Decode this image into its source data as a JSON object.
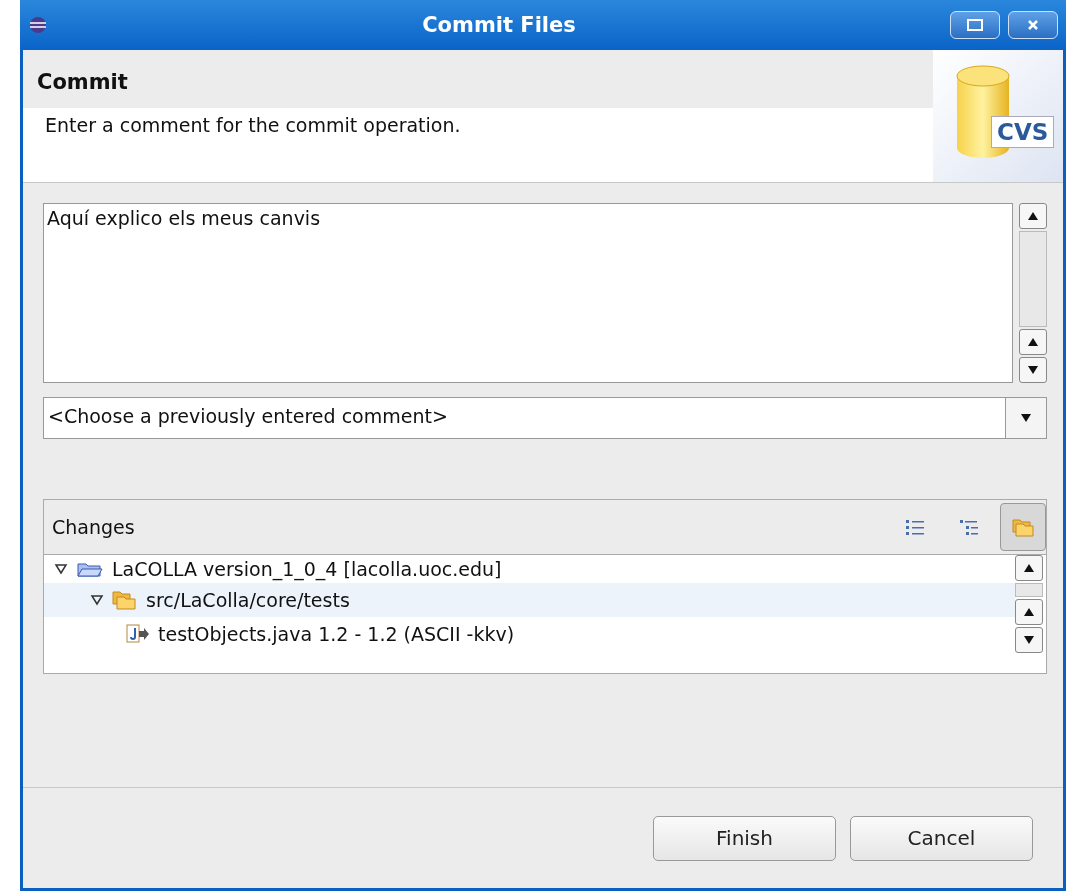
{
  "window": {
    "title": "Commit Files"
  },
  "header": {
    "title": "Commit",
    "description": "Enter a comment for the commit operation.",
    "logo_text": "CVS"
  },
  "comment": {
    "value": "Aquí explico els meus canvis"
  },
  "previous_comments": {
    "value": "<Choose a previously entered comment>"
  },
  "changes": {
    "title": "Changes",
    "view_buttons": [
      {
        "kind": "flat",
        "selected": false
      },
      {
        "kind": "tree",
        "selected": false
      },
      {
        "kind": "folders",
        "selected": true
      }
    ],
    "tree": [
      {
        "kind": "project",
        "label": "LaCOLLA  version_1_0_4 [lacolla.uoc.edu]",
        "expanded": true,
        "selected": false,
        "children": [
          {
            "kind": "folder",
            "label": "src/LaColla/core/tests",
            "expanded": true,
            "selected": true,
            "children": [
              {
                "kind": "file",
                "label": "testObjects.java  1.2 - 1.2  (ASCII -kkv)",
                "selected": false
              }
            ]
          }
        ]
      }
    ]
  },
  "buttons": [
    {
      "label": "Finish"
    },
    {
      "label": "Cancel"
    }
  ]
}
